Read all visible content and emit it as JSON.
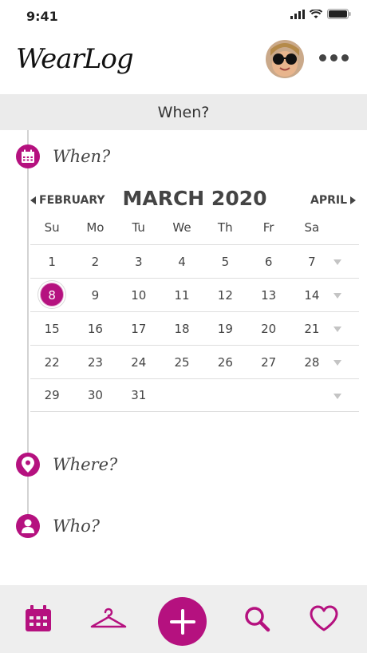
{
  "status_bar": {
    "time": "9:41"
  },
  "header": {
    "app_name": "WearLog"
  },
  "section": {
    "title": "When?"
  },
  "steps": [
    {
      "label": "When?",
      "icon": "calendar-icon"
    },
    {
      "label": "Where?",
      "icon": "location-pin-icon"
    },
    {
      "label": "Who?",
      "icon": "person-icon"
    }
  ],
  "calendar": {
    "prev_label": "FEBRUARY",
    "month_label": "MARCH 2020",
    "next_label": "APRIL",
    "weekdays": [
      "Su",
      "Mo",
      "Tu",
      "We",
      "Th",
      "Fr",
      "Sa"
    ],
    "weeks": [
      [
        "1",
        "2",
        "3",
        "4",
        "5",
        "6",
        "7"
      ],
      [
        "8",
        "9",
        "10",
        "11",
        "12",
        "13",
        "14"
      ],
      [
        "15",
        "16",
        "17",
        "18",
        "19",
        "20",
        "21"
      ],
      [
        "22",
        "23",
        "24",
        "25",
        "26",
        "27",
        "28"
      ],
      [
        "29",
        "30",
        "31",
        "",
        "",
        "",
        ""
      ]
    ],
    "selected_day": "8"
  },
  "bottom_nav": {
    "items": [
      "calendar-icon",
      "hanger-icon",
      "add-icon",
      "search-icon",
      "heart-icon"
    ]
  },
  "colors": {
    "accent": "#b5117f",
    "nav_bg": "#eeeeee",
    "section_bg": "#ebebeb"
  }
}
